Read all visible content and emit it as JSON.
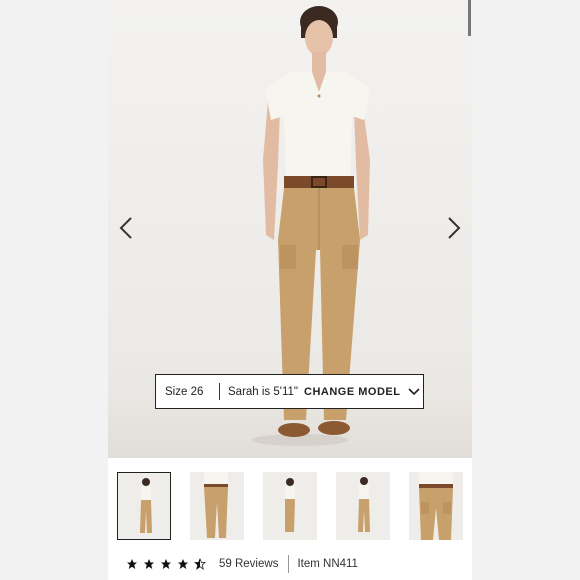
{
  "navigation": {
    "prev_icon": "chevron-left-icon",
    "next_icon": "chevron-right-icon"
  },
  "size_bar": {
    "size": "Size 26",
    "model_height": "Sarah is 5'11\"",
    "change_model": "CHANGE MODEL",
    "dropdown_icon": "chevron-down-icon"
  },
  "thumbnails": [
    {
      "view": "front full",
      "selected": true
    },
    {
      "view": "front close"
    },
    {
      "view": "side"
    },
    {
      "view": "front"
    },
    {
      "view": "detail"
    }
  ],
  "product_info": {
    "rating": 4.5,
    "rating_max": 5,
    "reviews": "59 Reviews",
    "item": "Item NN411"
  },
  "colors": {
    "pants": "#c8a06c",
    "top": "#f7f5ef",
    "belt": "#7a4a2a",
    "text": "#222222"
  }
}
